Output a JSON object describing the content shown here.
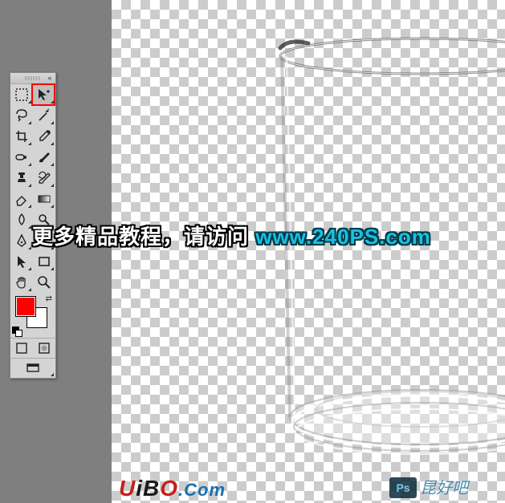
{
  "overlay": {
    "cn_text": "更多精品教程，请访问 ",
    "url_text": "www.240PS.com"
  },
  "watermarks": {
    "ps_badge": "Ps",
    "cn_signature": "昆好吧",
    "uibo_u": "U",
    "uibo_i": "i",
    "uibo_b": "B",
    "uibo_o": "O",
    "uibo_com": ".Com"
  },
  "tools_panel": {
    "selected_tool": "move-tool",
    "foreground_color": "#ff0000",
    "background_color": "#ffffff",
    "tools": [
      {
        "name": "rectangular-marquee-tool"
      },
      {
        "name": "move-tool"
      },
      {
        "name": "lasso-tool"
      },
      {
        "name": "magic-wand-tool"
      },
      {
        "name": "crop-tool"
      },
      {
        "name": "eyedropper-tool"
      },
      {
        "name": "spot-healing-brush-tool"
      },
      {
        "name": "brush-tool"
      },
      {
        "name": "clone-stamp-tool"
      },
      {
        "name": "history-brush-tool"
      },
      {
        "name": "eraser-tool"
      },
      {
        "name": "gradient-tool"
      },
      {
        "name": "blur-tool"
      },
      {
        "name": "dodge-tool"
      },
      {
        "name": "pen-tool"
      },
      {
        "name": "type-tool"
      },
      {
        "name": "path-selection-tool"
      },
      {
        "name": "rectangle-shape-tool"
      },
      {
        "name": "hand-tool"
      },
      {
        "name": "zoom-tool"
      }
    ],
    "mode_standard": "standard-mode",
    "mode_quickmask": "quick-mask-mode"
  }
}
